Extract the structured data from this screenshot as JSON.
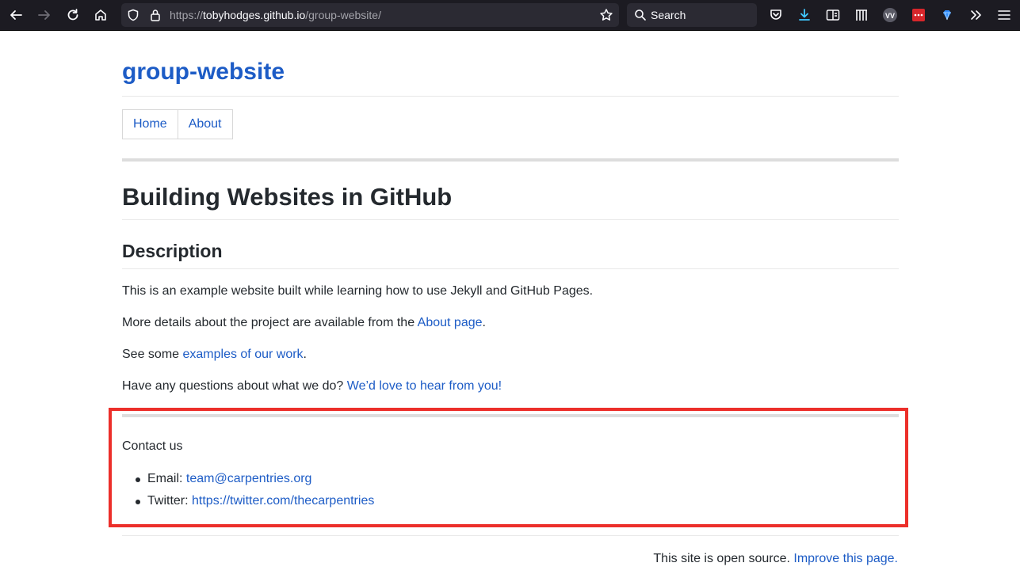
{
  "browser": {
    "url_prefix": "https://",
    "url_domain": "tobyhodges.github.io",
    "url_path": "/group-website/",
    "search_placeholder": "Search",
    "extension_badge": "VV"
  },
  "site": {
    "title": "group-website",
    "nav": [
      {
        "label": "Home"
      },
      {
        "label": "About"
      }
    ]
  },
  "main": {
    "heading": "Building Websites in GitHub",
    "subheading": "Description",
    "paragraphs": {
      "p1": "This is an example website built while learning how to use Jekyll and GitHub Pages.",
      "p2_text": "More details about the project are available from the ",
      "p2_link": "About page",
      "p2_end": ".",
      "p3_text": "See some ",
      "p3_link": "examples of our work",
      "p3_end": ".",
      "p4_text": "Have any questions about what we do? ",
      "p4_link": "We’d love to hear from you!"
    }
  },
  "contact": {
    "heading": "Contact us",
    "email_label": "Email: ",
    "email_value": "team@carpentries.org",
    "twitter_label": "Twitter: ",
    "twitter_value": "https://twitter.com/thecarpentries"
  },
  "footer": {
    "text": "This site is open source. ",
    "link": "Improve this page."
  },
  "colors": {
    "link": "#1d5cc6",
    "highlight": "#ec2f2a",
    "toolbar_bg": "#1c1b22"
  }
}
